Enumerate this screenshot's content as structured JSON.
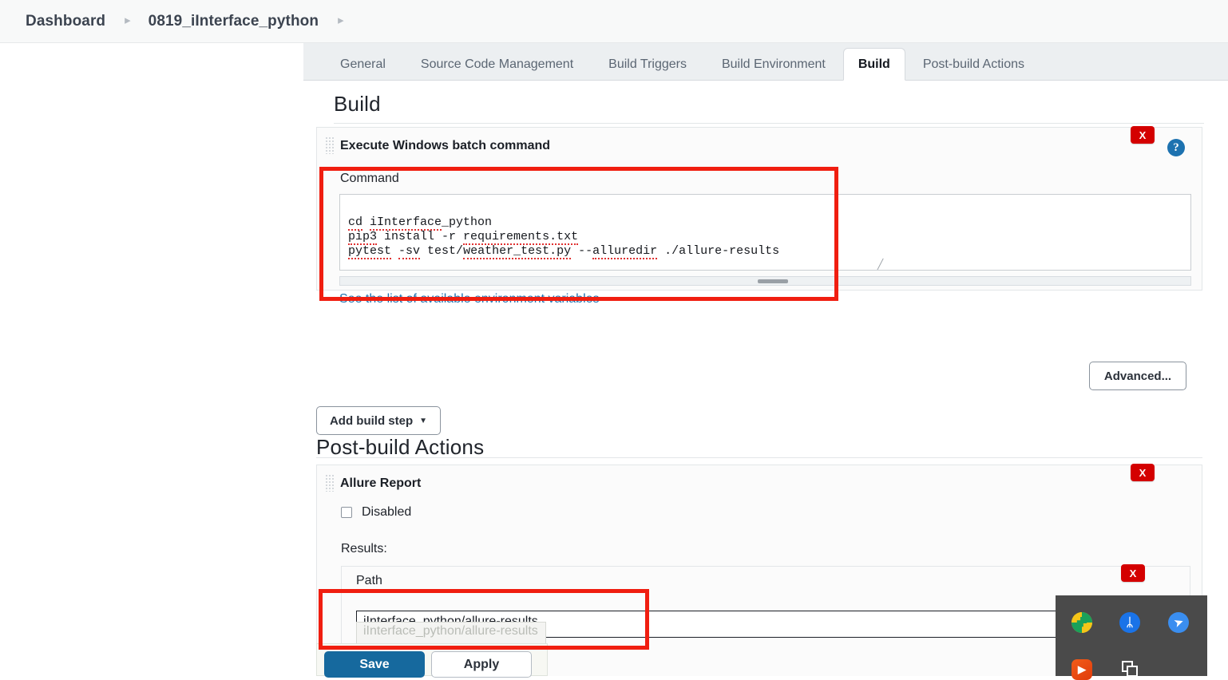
{
  "breadcrumb": {
    "items": [
      "Dashboard",
      "0819_iInterface_python"
    ],
    "separator": "▸"
  },
  "tabs": [
    {
      "label": "General",
      "active": false
    },
    {
      "label": "Source Code Management",
      "active": false
    },
    {
      "label": "Build Triggers",
      "active": false
    },
    {
      "label": "Build Environment",
      "active": false
    },
    {
      "label": "Build",
      "active": true
    },
    {
      "label": "Post-build Actions",
      "active": false
    }
  ],
  "build_section": {
    "heading": "Build",
    "step_title": "Execute Windows batch command",
    "command_label": "Command",
    "command_value": "cd iInterface_python\npip3 install -r requirements.txt\npytest -sv test/weather_test.py --alluredir ./allure-results",
    "command_lines": [
      "cd iInterface_python",
      "pip3 install -r requirements.txt",
      "pytest -sv test/weather_test.py --alluredir ./allure-results"
    ],
    "env_link": "See the list of available environment variables",
    "advanced_label": "Advanced...",
    "add_build_step_label": "Add build step",
    "remove_label": "X",
    "help_label": "?"
  },
  "postbuild_section": {
    "heading": "Post-build Actions",
    "step_title": "Allure Report",
    "disabled_label": "Disabled",
    "disabled_checked": false,
    "results_label": "Results:",
    "path_label": "Path",
    "path_value": "iInterface_python/allure-results",
    "path_suggestion": "iInterface_python/allure-results",
    "remove_label": "X"
  },
  "footer": {
    "save_label": "Save",
    "apply_label": "Apply"
  },
  "tray": {
    "icons": [
      {
        "name": "wps-plus-icon",
        "glyph": "✚"
      },
      {
        "name": "bluetooth-icon",
        "glyph": "ᛦ"
      },
      {
        "name": "send-paperplane-icon",
        "glyph": "➤"
      },
      {
        "name": "video-player-icon",
        "glyph": "▶"
      },
      {
        "name": "copy-windows-icon",
        "glyph": "❐"
      }
    ]
  },
  "colors": {
    "accent_blue": "#1d72b0",
    "save_blue": "#16699e",
    "danger_red": "#d40000",
    "annotation_red": "#f01e10",
    "tab_bar_bg": "#eceff1"
  },
  "annotations": [
    {
      "name": "command-highlight"
    },
    {
      "name": "path-highlight"
    }
  ]
}
